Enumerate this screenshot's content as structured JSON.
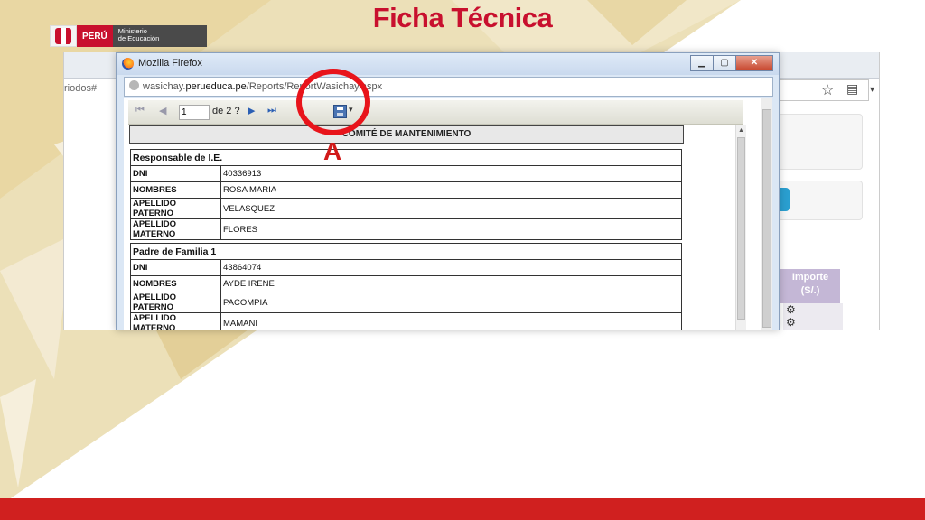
{
  "slide": {
    "title": "Ficha Técnica",
    "logo": {
      "country": "PERÚ",
      "ministry_line1": "Ministerio",
      "ministry_line2": "de Educación"
    }
  },
  "background_browser": {
    "url_fragment": "riodos#",
    "importe_header_line1": "Importe",
    "importe_header_line2": "(S/.)",
    "icons": [
      "star-icon",
      "bookmarks-icon",
      "menu-caret-icon"
    ]
  },
  "popup": {
    "window_title": "Mozilla Firefox",
    "url_prefix": "wasichay.",
    "url_domain": "perueduca.pe",
    "url_path": "/Reports/ReportWasichay.aspx",
    "controls": {
      "minimize": "▁",
      "maximize": "▢",
      "close": "✕"
    }
  },
  "report_toolbar": {
    "first_page": "⏮",
    "prev_page": "◀",
    "next_page": "▶",
    "last_page": "⏭",
    "current_page": "1",
    "page_of": "de 2 ?",
    "save_caret": "▾"
  },
  "report": {
    "banner": "COMITÉ DE MANTENIMIENTO",
    "sections": [
      {
        "title": "Responsable de I.E.",
        "rows": [
          {
            "label": "DNI",
            "value": "40336913"
          },
          {
            "label": "NOMBRES",
            "value": "ROSA MARIA"
          },
          {
            "label": "APELLIDO PATERNO",
            "value": "VELASQUEZ"
          },
          {
            "label": "APELLIDO MATERNO",
            "value": "FLORES"
          }
        ]
      },
      {
        "title": "Padre de Familia 1",
        "rows": [
          {
            "label": "DNI",
            "value": "43864074"
          },
          {
            "label": "NOMBRES",
            "value": "AYDE IRENE"
          },
          {
            "label": "APELLIDO PATERNO",
            "value": "PACOMPIA"
          },
          {
            "label": "APELLIDO MATERNO",
            "value": "MAMANI"
          }
        ]
      }
    ]
  },
  "annotation": {
    "letter": "A",
    "color": "#e8141b"
  },
  "colors": {
    "brand_red": "#c8102e",
    "footer_red": "#d0201f",
    "pattern_gold": "#e6cf8f"
  }
}
